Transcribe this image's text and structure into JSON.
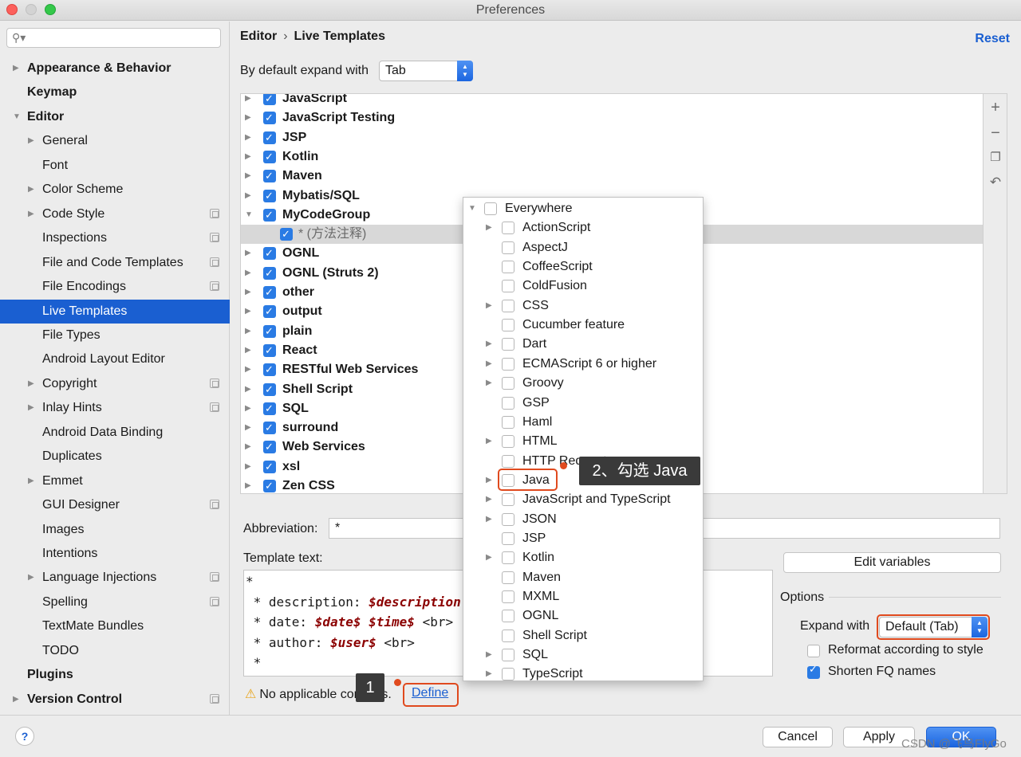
{
  "window": {
    "title": "Preferences"
  },
  "sidebar": {
    "search_placeholder": "",
    "items": [
      {
        "label": "Appearance & Behavior",
        "bold": true,
        "arrow": "right",
        "indent": 0
      },
      {
        "label": "Keymap",
        "bold": true,
        "arrow": "",
        "indent": 0
      },
      {
        "label": "Editor",
        "bold": true,
        "arrow": "down",
        "indent": 0
      },
      {
        "label": "General",
        "arrow": "right",
        "indent": 1
      },
      {
        "label": "Font",
        "arrow": "",
        "indent": 1
      },
      {
        "label": "Color Scheme",
        "arrow": "right",
        "indent": 1
      },
      {
        "label": "Code Style",
        "arrow": "right",
        "indent": 1,
        "copy": true
      },
      {
        "label": "Inspections",
        "arrow": "",
        "indent": 1,
        "copy": true
      },
      {
        "label": "File and Code Templates",
        "arrow": "",
        "indent": 1,
        "copy": true
      },
      {
        "label": "File Encodings",
        "arrow": "",
        "indent": 1,
        "copy": true
      },
      {
        "label": "Live Templates",
        "arrow": "",
        "indent": 1,
        "selected": true
      },
      {
        "label": "File Types",
        "arrow": "",
        "indent": 1
      },
      {
        "label": "Android Layout Editor",
        "arrow": "",
        "indent": 1
      },
      {
        "label": "Copyright",
        "arrow": "right",
        "indent": 1,
        "copy": true
      },
      {
        "label": "Inlay Hints",
        "arrow": "right",
        "indent": 1,
        "copy": true
      },
      {
        "label": "Android Data Binding",
        "arrow": "",
        "indent": 1
      },
      {
        "label": "Duplicates",
        "arrow": "",
        "indent": 1
      },
      {
        "label": "Emmet",
        "arrow": "right",
        "indent": 1
      },
      {
        "label": "GUI Designer",
        "arrow": "",
        "indent": 1,
        "copy": true
      },
      {
        "label": "Images",
        "arrow": "",
        "indent": 1
      },
      {
        "label": "Intentions",
        "arrow": "",
        "indent": 1
      },
      {
        "label": "Language Injections",
        "arrow": "right",
        "indent": 1,
        "copy": true
      },
      {
        "label": "Spelling",
        "arrow": "",
        "indent": 1,
        "copy": true
      },
      {
        "label": "TextMate Bundles",
        "arrow": "",
        "indent": 1
      },
      {
        "label": "TODO",
        "arrow": "",
        "indent": 1
      },
      {
        "label": "Plugins",
        "bold": true,
        "arrow": "",
        "indent": 0
      },
      {
        "label": "Version Control",
        "bold": true,
        "arrow": "right",
        "indent": 0,
        "copy": true
      }
    ]
  },
  "header": {
    "breadcrumb_root": "Editor",
    "breadcrumb_sep": "›",
    "breadcrumb_page": "Live Templates",
    "reset_label": "Reset",
    "expand_label": "By default expand with",
    "expand_value": "Tab"
  },
  "templates": {
    "groups": [
      {
        "label": "JavaScript",
        "checked": true,
        "arrow": "right"
      },
      {
        "label": "JavaScript Testing",
        "checked": true,
        "arrow": "right"
      },
      {
        "label": "JSP",
        "checked": true,
        "arrow": "right"
      },
      {
        "label": "Kotlin",
        "checked": true,
        "arrow": "right"
      },
      {
        "label": "Maven",
        "checked": true,
        "arrow": "right"
      },
      {
        "label": "Mybatis/SQL",
        "checked": true,
        "arrow": "right"
      },
      {
        "label": "MyCodeGroup",
        "checked": true,
        "arrow": "down"
      },
      {
        "label": "* (方法注释)",
        "checked": true,
        "arrow": "",
        "child": true,
        "selected": true
      },
      {
        "label": "OGNL",
        "checked": true,
        "arrow": "right"
      },
      {
        "label": "OGNL (Struts 2)",
        "checked": true,
        "arrow": "right"
      },
      {
        "label": "other",
        "checked": true,
        "arrow": "right"
      },
      {
        "label": "output",
        "checked": true,
        "arrow": "right"
      },
      {
        "label": "plain",
        "checked": true,
        "arrow": "right"
      },
      {
        "label": "React",
        "checked": true,
        "arrow": "right"
      },
      {
        "label": "RESTful Web Services",
        "checked": true,
        "arrow": "right"
      },
      {
        "label": "Shell Script",
        "checked": true,
        "arrow": "right"
      },
      {
        "label": "SQL",
        "checked": true,
        "arrow": "right"
      },
      {
        "label": "surround",
        "checked": true,
        "arrow": "right"
      },
      {
        "label": "Web Services",
        "checked": true,
        "arrow": "right"
      },
      {
        "label": "xsl",
        "checked": true,
        "arrow": "right"
      },
      {
        "label": "Zen CSS",
        "checked": true,
        "arrow": "right"
      }
    ],
    "tools": [
      "plus-icon",
      "minus-icon",
      "copy-icon",
      "undo-icon"
    ]
  },
  "editor": {
    "abbreviation_label": "Abbreviation:",
    "abbreviation_value": "*",
    "template_text_label": "Template text:",
    "lines": [
      {
        "parts": [
          {
            "t": "*",
            "v": false
          }
        ]
      },
      {
        "parts": [
          {
            "t": " * description: ",
            "v": false
          },
          {
            "t": "$description",
            "v": true
          }
        ]
      },
      {
        "parts": [
          {
            "t": " * date: ",
            "v": false
          },
          {
            "t": "$date$ $time$",
            "v": true
          },
          {
            "t": " <br>",
            "v": false
          }
        ]
      },
      {
        "parts": [
          {
            "t": " * author: ",
            "v": false
          },
          {
            "t": "$user$",
            "v": true
          },
          {
            "t": " <br>",
            "v": false
          }
        ]
      },
      {
        "parts": [
          {
            "t": " *",
            "v": false
          }
        ]
      }
    ],
    "edit_variables_label": "Edit variables",
    "options_label": "Options",
    "expand_with_label": "Expand with",
    "expand_with_value": "Default (Tab)",
    "reformat_label": "Reformat according to style",
    "reformat_checked": false,
    "shorten_label": "Shorten FQ names",
    "shorten_checked": true,
    "warning_text": "No applicable contexts.",
    "define_label": "Define"
  },
  "context_popup": {
    "items": [
      {
        "label": "Everywhere",
        "arrow": "down",
        "level": 0
      },
      {
        "label": "ActionScript",
        "arrow": "right",
        "level": 1
      },
      {
        "label": "AspectJ",
        "arrow": "",
        "level": 1
      },
      {
        "label": "CoffeeScript",
        "arrow": "",
        "level": 1
      },
      {
        "label": "ColdFusion",
        "arrow": "",
        "level": 1
      },
      {
        "label": "CSS",
        "arrow": "right",
        "level": 1
      },
      {
        "label": "Cucumber feature",
        "arrow": "",
        "level": 1
      },
      {
        "label": "Dart",
        "arrow": "right",
        "level": 1
      },
      {
        "label": "ECMAScript 6 or higher",
        "arrow": "right",
        "level": 1
      },
      {
        "label": "Groovy",
        "arrow": "right",
        "level": 1
      },
      {
        "label": "GSP",
        "arrow": "",
        "level": 1
      },
      {
        "label": "Haml",
        "arrow": "",
        "level": 1
      },
      {
        "label": "HTML",
        "arrow": "right",
        "level": 1
      },
      {
        "label": "HTTP Request",
        "arrow": "",
        "level": 1
      },
      {
        "label": "Java",
        "arrow": "right",
        "level": 1,
        "highlight": true
      },
      {
        "label": "JavaScript and TypeScript",
        "arrow": "right",
        "level": 1
      },
      {
        "label": "JSON",
        "arrow": "right",
        "level": 1
      },
      {
        "label": "JSP",
        "arrow": "",
        "level": 1
      },
      {
        "label": "Kotlin",
        "arrow": "right",
        "level": 1
      },
      {
        "label": "Maven",
        "arrow": "",
        "level": 1
      },
      {
        "label": "MXML",
        "arrow": "",
        "level": 1
      },
      {
        "label": "OGNL",
        "arrow": "",
        "level": 1
      },
      {
        "label": "Shell Script",
        "arrow": "",
        "level": 1
      },
      {
        "label": "SQL",
        "arrow": "right",
        "level": 1
      },
      {
        "label": "TypeScript",
        "arrow": "right",
        "level": 1
      }
    ]
  },
  "annotations": {
    "step1": "1",
    "step2": "2、勾选 Java"
  },
  "footer": {
    "help_label": "?",
    "cancel_label": "Cancel",
    "apply_label": "Apply",
    "ok_label": "OK",
    "watermark": "CSDN @飞鸟FlyGo"
  },
  "colors": {
    "accent": "#1a5fd1",
    "checkbox": "#2a7be4",
    "annotation_red": "#e04a1e",
    "variable": "#8b0000"
  }
}
